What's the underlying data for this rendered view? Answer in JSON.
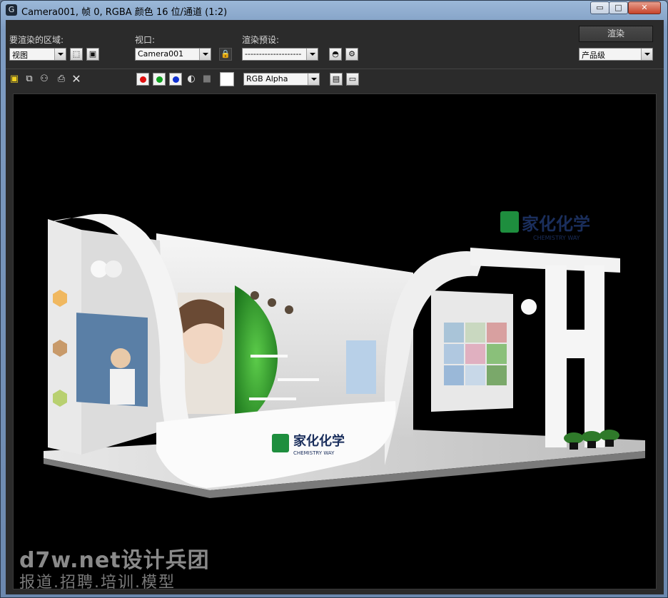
{
  "window": {
    "title": "Camera001, 帧 0, RGBA 颜色 16 位/通道 (1:2)",
    "icon": "3dsmax-icon",
    "controls": {
      "minimize": "▭",
      "maximize": "□",
      "close": "✕"
    }
  },
  "toolbar": {
    "area_label": "要渲染的区域:",
    "area_value": "视图",
    "viewport_label": "视口:",
    "viewport_value": "Camera001",
    "preset_label": "渲染预设:",
    "preset_value": "--------------------",
    "render_button": "渲染",
    "quality_value": "产品级",
    "channel_display": "RGB Alpha"
  },
  "channels": {
    "red": "#e01010",
    "green": "#10a020",
    "blue": "#1030d0"
  },
  "scene": {
    "brand_cn": "家化化学",
    "brand_en": "CHEMISTRY WAY",
    "accent_green": "#2e9a2e",
    "brand_blue": "#1a2e5c"
  },
  "watermark": {
    "line1": "d7w.net设计兵团",
    "line2": "报道.招聘.培训.模型"
  }
}
